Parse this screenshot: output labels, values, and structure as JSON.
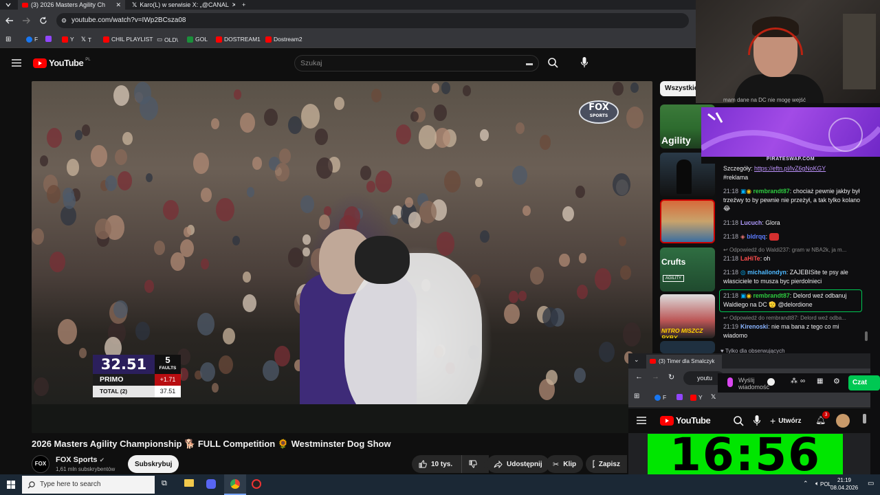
{
  "browser": {
    "tabs": [
      {
        "label": "(3) 2026 Masters Agility Ch",
        "active": true
      },
      {
        "label": "Karo(L) w serwisie X: „@CANAL",
        "active": false
      }
    ],
    "url": "youtube.com/watch?v=IWp2BCsza08",
    "bookmarks": [
      "F",
      "Y",
      "T",
      "CHIL PLAYLIST",
      "OLD\\",
      "GOL",
      "DOSTREAM1",
      "Dostream2"
    ]
  },
  "youtube": {
    "logo_text": "YouTube",
    "logo_sup": "PL",
    "search_placeholder": "Szukaj",
    "filter_chip": "Wszystkie",
    "video": {
      "broadcaster_logo": "FOX",
      "broadcaster_sub": "SPORTS",
      "scoreboard": {
        "time": "32.51",
        "faults": "5",
        "faults_label": "FAULTS",
        "competitor": "PRIMO",
        "diff": "+1.71",
        "total_label": "TOTAL (2)",
        "total": "37.51"
      }
    },
    "title": "2026 Masters Agility Championship 🐕 FULL Competition 🌻 Westminster Dog Show",
    "channel": {
      "name": "FOX Sports",
      "subscribers": "1,61 mln subskrybentów",
      "logo": "FOX",
      "subscribe_label": "Subskrybuj"
    },
    "actions": {
      "likes": "10 tys.",
      "share": "Udostępnij",
      "clip": "Klip",
      "save": "Zapisz"
    },
    "suggestions": [
      {
        "label": "Agility"
      },
      {
        "label": ""
      },
      {
        "label": ""
      },
      {
        "label": "Crufts",
        "sub": "AGILITY"
      },
      {
        "label": "NITRO MISZCZ RYBY"
      },
      {
        "label": ""
      }
    ]
  },
  "chat": {
    "top_partial": "mam dane na DC nie mogę wejść",
    "banner_label": "PIRATESWAP.COM",
    "details_prefix": "Szczegóły:",
    "details_link": "https://eftn.pl/lvZ6gNoKGY",
    "details_tag": "#reklama",
    "messages": [
      {
        "time": "21:18",
        "user": "rembrandt87",
        "text": "chociaż pewnie jakby był trzeźwy to by pewnie nie przeżył, a tak tylko kolano 😂",
        "color": "#2ecc40"
      },
      {
        "time": "21:18",
        "user": "Lucuch",
        "text": "Glora",
        "color": "#b19cff"
      },
      {
        "time": "21:18",
        "user": "bldrqq",
        "text": "",
        "color": "#5c7cff"
      },
      {
        "reply": "Odpowiedź do Waldi237: gram w NBA2k, ja m..."
      },
      {
        "time": "21:18",
        "user": "LaHiTe",
        "text": "oh",
        "color": "#ff4d4d"
      },
      {
        "time": "21:18",
        "user": "michallondyn",
        "text": "ZAJEBISite te psy ale wlasciciele to musza byc pierdolnieci",
        "color": "#4db8ff"
      },
      {
        "time": "21:18",
        "user": "rembrandt87",
        "text": "Delord weź odbanuj Waldiego na DC 🫡 @delordione",
        "color": "#2ecc40"
      },
      {
        "reply": "Odpowiedź do rembrandt87: Delord weź odba..."
      },
      {
        "time": "21:19",
        "user": "Kirenoski",
        "text": "nie ma bana z tego co mi wiadomo",
        "color": "#8ab4ff"
      }
    ],
    "followers_only": "Tylko dla obserwujących",
    "input_placeholder": "Wyślij wiadomość",
    "send_label": "Czat"
  },
  "popup": {
    "tab_label": "(3) Timer dla Smalczyk",
    "url_partial": "youtu",
    "bookmarks": [
      "F",
      "Y"
    ],
    "yt_logo": "YouTube",
    "create_label": "Utwórz",
    "notif_count": "3",
    "timer": "16:56"
  },
  "taskbar": {
    "search_placeholder": "Type here to search",
    "lang": "POL",
    "time": "21:19",
    "date": "08.04.2026"
  }
}
